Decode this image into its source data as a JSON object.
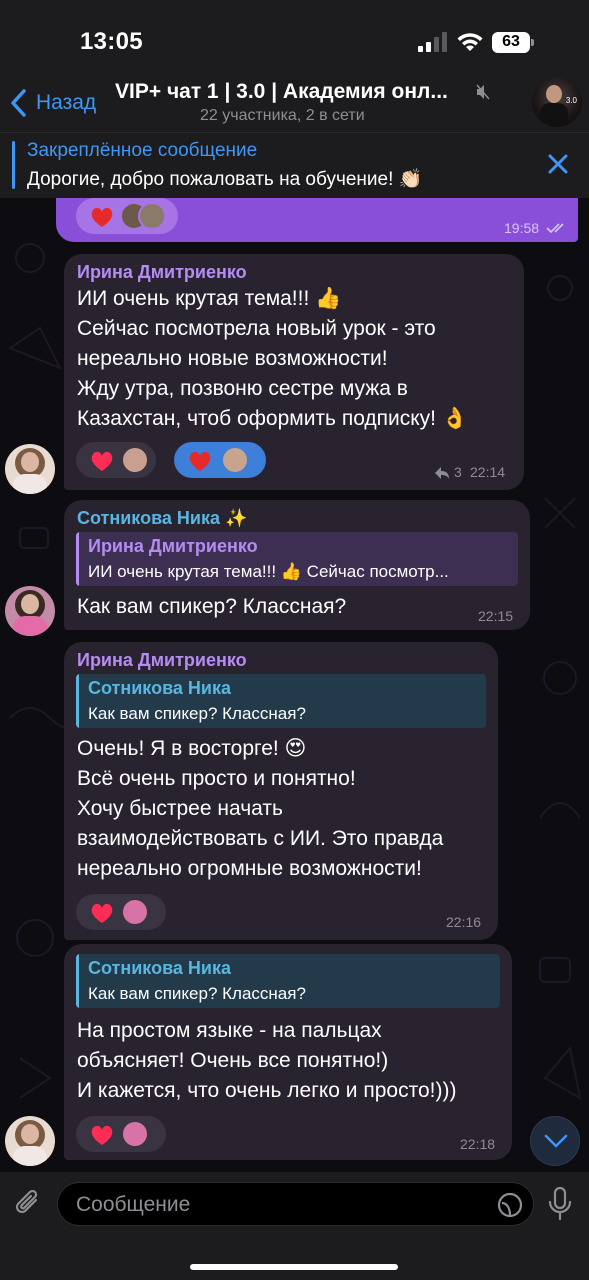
{
  "status": {
    "time": "13:05",
    "battery": "63"
  },
  "nav": {
    "back_label": "Назад",
    "title": "VIP+ чат 1 | 3.0 | Академия онл...",
    "subtitle": "22 участника, 2 в сети",
    "avatar_text": "3.0"
  },
  "pinned": {
    "title": "Закреплённое сообщение",
    "text": "Дорогие, добро пожаловать на обучение! 👏🏻"
  },
  "messages": [
    {
      "type": "outgoing",
      "time": "19:58"
    },
    {
      "sender": "Ирина Дмитриенко",
      "lines": [
        "ИИ очень крутая тема!!! 👍",
        "Сейчас посмотрела новый урок - это",
        "нереально новые возможности!",
        "Жду утра, позвоню сестре мужа в",
        "Казахстан, чтоб оформить подписку! 👌"
      ],
      "replies": "3",
      "time": "22:14"
    },
    {
      "sender": "Сотникова Ника ✨",
      "reply_name": "Ирина Дмитриенко",
      "reply_text": "ИИ очень крутая тема!!! 👍 Сейчас посмотр...",
      "lines": [
        "Как вам спикер? Классная?"
      ],
      "time": "22:15"
    },
    {
      "sender": "Ирина Дмитриенко",
      "reply_name": "Сотникова Ника",
      "reply_text": "Как вам спикер? Классная?",
      "lines": [
        "Очень! Я в восторге! 😍",
        "Всё очень просто и понятно!",
        "Хочу быстрее начать",
        "взаимодействовать с ИИ. Это правда",
        "нереально огромные возможности!"
      ],
      "time": "22:16"
    },
    {
      "reply_name": "Сотникова Ника",
      "reply_text": "Как вам спикер? Классная?",
      "lines": [
        "На простом языке - на пальцах",
        "объясняет! Очень все понятно!)",
        "И кажется, что очень легко и просто!)))"
      ],
      "time": "22:18"
    }
  ],
  "input": {
    "placeholder": "Сообщение"
  },
  "colors": {
    "accent": "#3e97f5",
    "purple_name": "#b48cf2",
    "teal_name": "#58b6e0",
    "outgoing": "#8a4fd8",
    "incoming": "#28232f"
  }
}
